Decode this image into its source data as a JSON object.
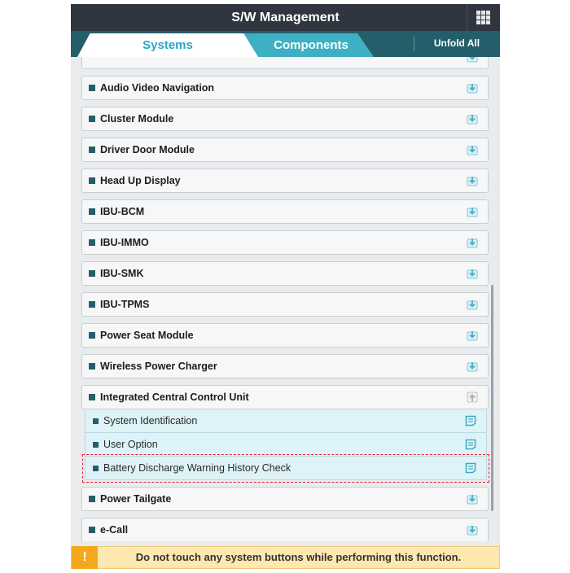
{
  "header": {
    "title": "S/W Management",
    "menu_icon": "grid-icon"
  },
  "tabs": [
    {
      "label": "Systems",
      "active": true
    },
    {
      "label": "Components",
      "active": false
    }
  ],
  "unfold_all_label": "Unfold All",
  "colors": {
    "header_bg": "#2f3640",
    "tabbar_bg": "#245e6a",
    "active_tab_text": "#2aa7c1",
    "inactive_tab_bg": "#3fb0c4",
    "subitem_bg": "#ddf3f8",
    "highlight_outline": "#e0202a",
    "warning_bg": "#fde9b0",
    "warning_icon_bg": "#f6a81d"
  },
  "systems": [
    {
      "label": "",
      "action_icon": "download-icon",
      "clipped": true
    },
    {
      "label": "Audio Video Navigation",
      "action_icon": "download-icon"
    },
    {
      "label": "Cluster Module",
      "action_icon": "download-icon"
    },
    {
      "label": "Driver Door Module",
      "action_icon": "download-icon"
    },
    {
      "label": "Head Up Display",
      "action_icon": "download-icon"
    },
    {
      "label": "IBU-BCM",
      "action_icon": "download-icon"
    },
    {
      "label": "IBU-IMMO",
      "action_icon": "download-icon"
    },
    {
      "label": "IBU-SMK",
      "action_icon": "download-icon"
    },
    {
      "label": "IBU-TPMS",
      "action_icon": "download-icon"
    },
    {
      "label": "Power Seat Module",
      "action_icon": "download-icon"
    },
    {
      "label": "Wireless Power Charger",
      "action_icon": "download-icon"
    },
    {
      "label": "Integrated Central Control Unit",
      "action_icon": "collapse-icon",
      "expanded": true,
      "children": [
        {
          "label": "System Identification",
          "action_icon": "document-icon"
        },
        {
          "label": "User Option",
          "action_icon": "document-icon"
        },
        {
          "label": "Battery Discharge Warning History Check",
          "action_icon": "document-icon",
          "highlighted": true
        }
      ]
    },
    {
      "label": "Power Tailgate",
      "action_icon": "download-icon"
    },
    {
      "label": "e-Call",
      "action_icon": "download-icon"
    }
  ],
  "warning": {
    "icon": "!",
    "text": "Do not touch any system buttons while performing this function."
  }
}
